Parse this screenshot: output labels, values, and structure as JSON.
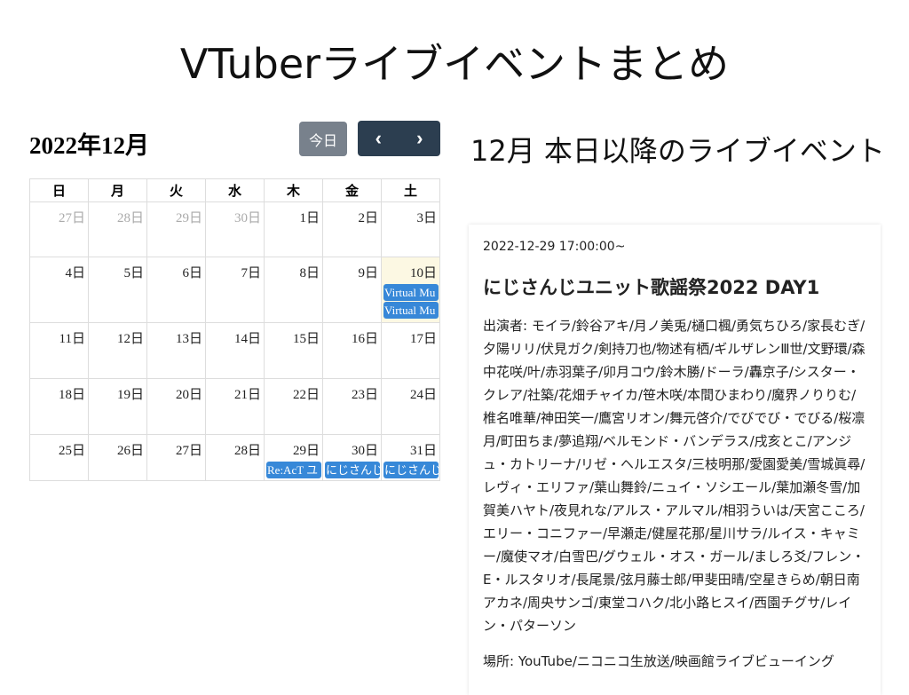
{
  "page": {
    "title": "VTuberライブイベントまとめ"
  },
  "calendar": {
    "month_title": "2022年12月",
    "today_label": "今日",
    "prev_icon": "chevron-left-icon",
    "next_icon": "chevron-right-icon",
    "weekdays": [
      "日",
      "月",
      "火",
      "水",
      "木",
      "金",
      "土"
    ],
    "today_highlight": "#fcf8e3",
    "event_color": "#3788d8",
    "weeks": [
      [
        {
          "d": "27日",
          "other": true
        },
        {
          "d": "28日",
          "other": true
        },
        {
          "d": "29日",
          "other": true
        },
        {
          "d": "30日",
          "other": true
        },
        {
          "d": "1日"
        },
        {
          "d": "2日"
        },
        {
          "d": "3日"
        }
      ],
      [
        {
          "d": "4日"
        },
        {
          "d": "5日"
        },
        {
          "d": "6日"
        },
        {
          "d": "7日"
        },
        {
          "d": "8日"
        },
        {
          "d": "9日"
        },
        {
          "d": "10日",
          "today": true,
          "events": [
            "Virtual Mu",
            "Virtual Mu"
          ]
        }
      ],
      [
        {
          "d": "11日"
        },
        {
          "d": "12日"
        },
        {
          "d": "13日"
        },
        {
          "d": "14日"
        },
        {
          "d": "15日"
        },
        {
          "d": "16日"
        },
        {
          "d": "17日"
        }
      ],
      [
        {
          "d": "18日"
        },
        {
          "d": "19日"
        },
        {
          "d": "20日"
        },
        {
          "d": "21日"
        },
        {
          "d": "22日"
        },
        {
          "d": "23日"
        },
        {
          "d": "24日"
        }
      ],
      [
        {
          "d": "25日"
        },
        {
          "d": "26日"
        },
        {
          "d": "27日"
        },
        {
          "d": "28日"
        },
        {
          "d": "29日",
          "events": [
            "Re:AcT ユ"
          ]
        },
        {
          "d": "30日",
          "events": [
            "にじさんじ"
          ]
        },
        {
          "d": "31日",
          "events": [
            "にじさんじ"
          ]
        }
      ]
    ]
  },
  "upcoming": {
    "heading": "12月 本日以降のライブイベント",
    "event": {
      "datetime": "2022-12-29 17:00:00~",
      "name": "にじさんじユニット歌謡祭2022 DAY1",
      "performers": "出演者: モイラ/鈴谷アキ/月ノ美兎/樋口楓/勇気ちひろ/家長むぎ/夕陽リリ/伏見ガク/剣持刀也/物述有栖/ギルザレンⅢ世/文野環/森中花咲/叶/赤羽葉子/卯月コウ/鈴木勝/ドーラ/轟京子/シスター・クレア/社築/花畑チャイカ/笹木咲/本間ひまわり/魔界ノりりむ/椎名唯華/神田笑一/鷹宮リオン/舞元啓介/でびでび・でびる/桜凛月/町田ちま/夢追翔/ベルモンド・バンデラス/戌亥とこ/アンジュ・カトリーナ/リゼ・ヘルエスタ/三枝明那/愛園愛美/雪城眞尋/レヴィ・エリファ/葉山舞鈴/ニュイ・ソシエール/葉加瀬冬雪/加賀美ハヤト/夜見れな/アルス・アルマル/相羽ういは/天宮こころ/エリー・コニファー/早瀬走/健屋花那/星川サラ/ルイス・キャミー/魔使マオ/白雪巴/グウェル・オス・ガール/ましろ爻/フレン・E・ルスタリオ/長尾景/弦月藤士郎/甲斐田晴/空星きらめ/朝日南アカネ/周央サンゴ/東堂コハク/北小路ヒスイ/西園チグサ/レイン・パターソン",
      "venue": "場所: YouTube/ニコニコ生放送/映画館ライブビューイング"
    }
  }
}
